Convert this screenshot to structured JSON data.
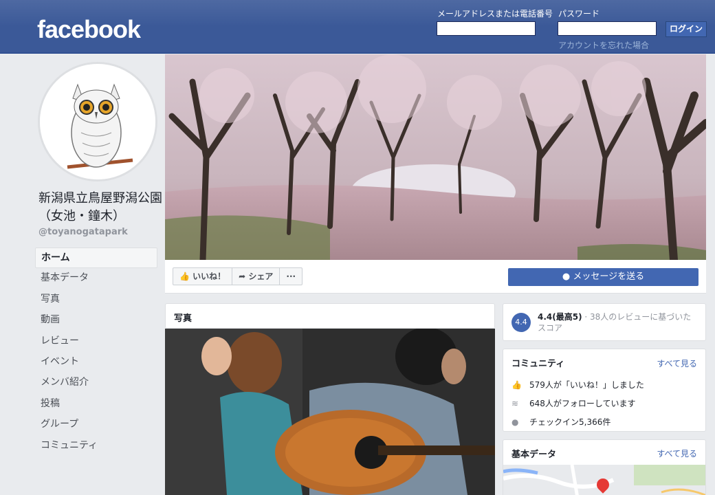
{
  "header": {
    "logo": "facebook",
    "email_label": "メールアドレスまたは電話番号",
    "password_label": "パスワード",
    "login_button": "ログイン",
    "forgot_link": "アカウントを忘れた場合"
  },
  "page": {
    "name": "新潟県立鳥屋野潟公園（女池・鐘木）",
    "handle": "@toyanogatapark"
  },
  "nav": {
    "items": [
      "ホーム",
      "基本データ",
      "写真",
      "動画",
      "レビュー",
      "イベント",
      "メンバ紹介",
      "投稿",
      "グループ",
      "コミュニティ"
    ]
  },
  "actions": {
    "like": "いいね！",
    "share": "シェア",
    "more": "···",
    "message": "メッセージを送る"
  },
  "photos": {
    "title": "写真"
  },
  "rating": {
    "score": "4.4",
    "summary_bold": "4.4(最高5)",
    "summary_rest": " · 38人のレビューに基づいたスコア"
  },
  "community": {
    "title": "コミュニティ",
    "see_all": "すべて見る",
    "likes": "579人が「いいね！」しました",
    "follows": "648人がフォローしています",
    "checkins": "チェックイン5,366件"
  },
  "about": {
    "title": "基本データ",
    "see_all": "すべて見る"
  },
  "colors": {
    "brand": "#3b5998",
    "button": "#4267b2",
    "background": "#e9ebee"
  }
}
